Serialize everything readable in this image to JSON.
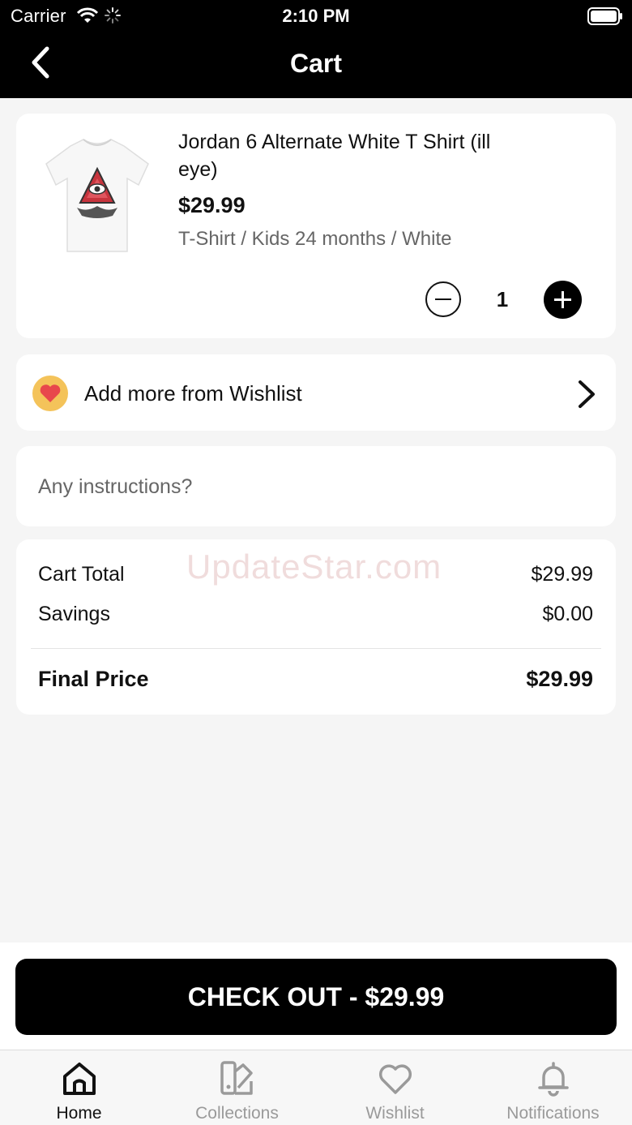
{
  "status_bar": {
    "carrier": "Carrier",
    "time": "2:10 PM"
  },
  "nav": {
    "title": "Cart",
    "back_icon": "chevron-left-icon"
  },
  "cart_item": {
    "name": "Jordan 6 Alternate White T Shirt (ill eye)",
    "price": "$29.99",
    "variant": "T-Shirt / Kids 24 months / White",
    "quantity": "1",
    "image": "white-tshirt-illuminati-eye-print"
  },
  "wishlist_row": {
    "label": "Add more from Wishlist",
    "icon": "heart-badge-icon",
    "chevron": "chevron-right-icon"
  },
  "instructions": {
    "placeholder": "Any instructions?",
    "value": ""
  },
  "summary": {
    "watermark": "UpdateStar.com",
    "cart_total_label": "Cart Total",
    "cart_total_value": "$29.99",
    "savings_label": "Savings",
    "savings_value": "$0.00",
    "final_price_label": "Final Price",
    "final_price_value": "$29.99"
  },
  "checkout": {
    "label": "CHECK OUT - $29.99"
  },
  "tabs": [
    {
      "label": "Home",
      "icon": "home-icon",
      "active": true
    },
    {
      "label": "Collections",
      "icon": "collections-icon",
      "active": false
    },
    {
      "label": "Wishlist",
      "icon": "heart-icon",
      "active": false
    },
    {
      "label": "Notifications",
      "icon": "bell-icon",
      "active": false
    }
  ],
  "colors": {
    "header_bg": "#000000",
    "page_bg": "#f5f5f5",
    "card_bg": "#ffffff",
    "accent": "#000000",
    "inactive_tab": "#9a9a9a",
    "wishlist_badge": "#f4c35a",
    "heart": "#e8474c"
  }
}
